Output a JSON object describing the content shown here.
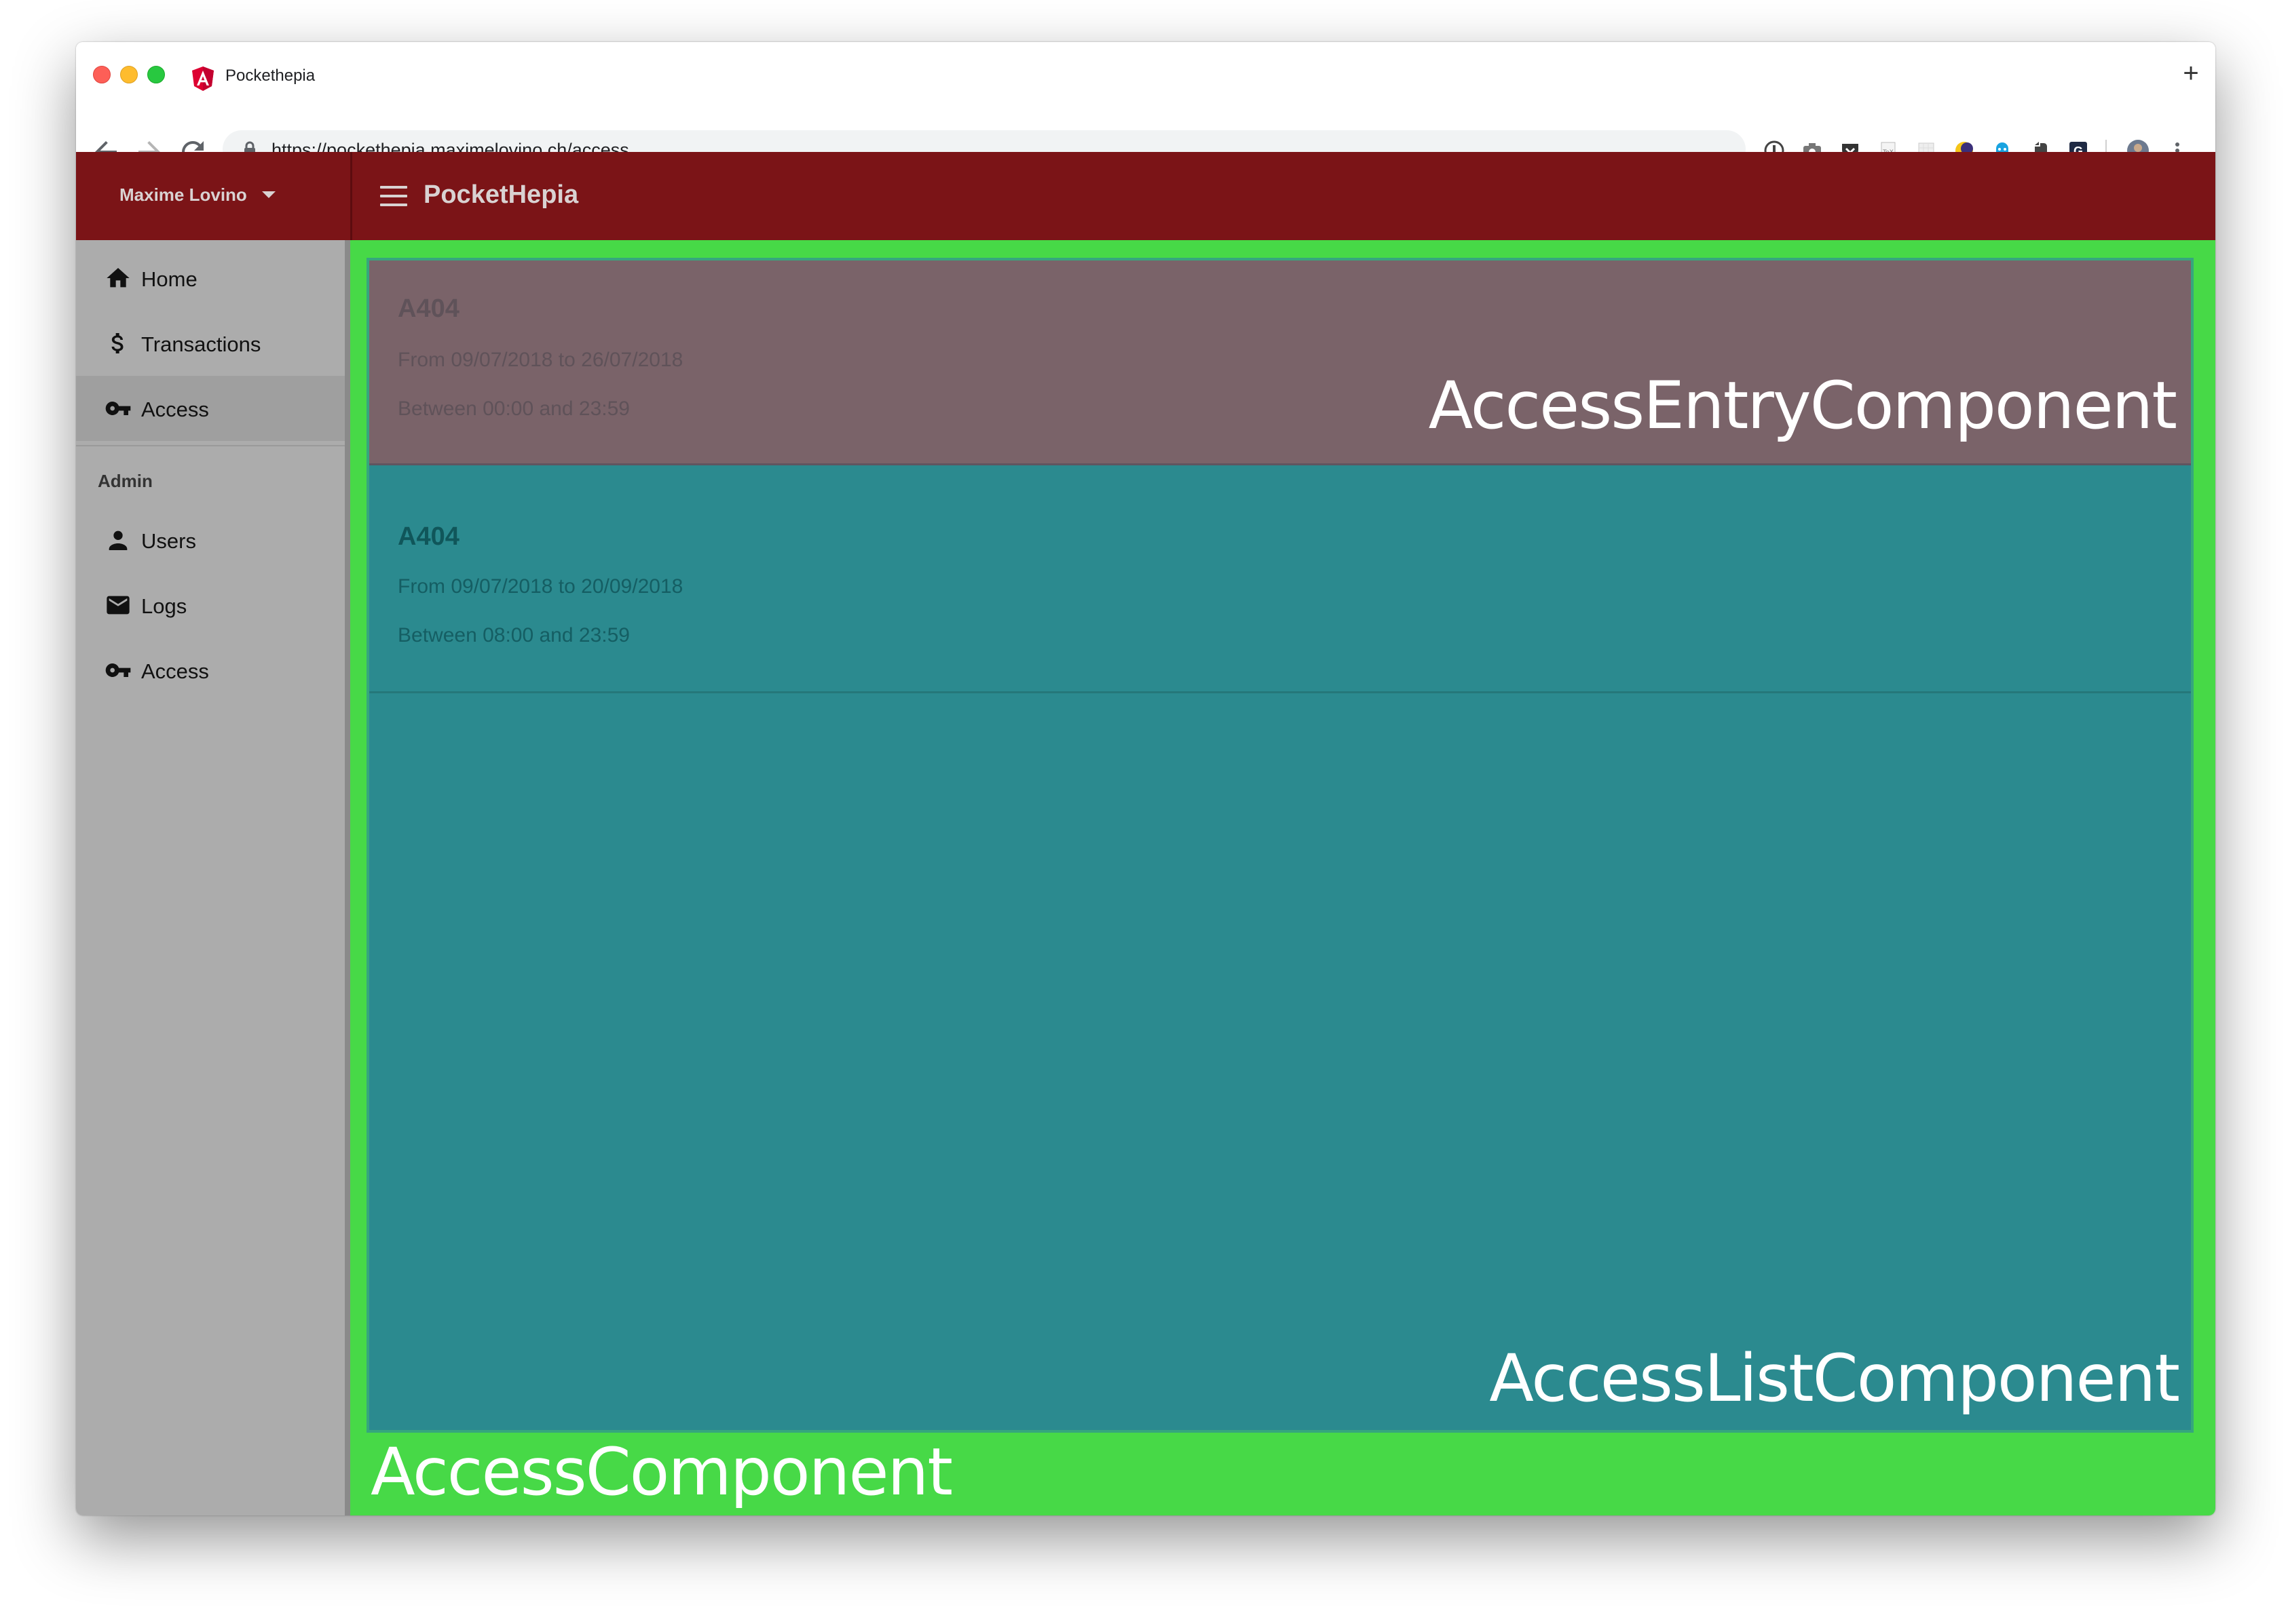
{
  "browser": {
    "tab_title": "Pockethepia",
    "new_tab": "+",
    "url": "https://pockethepia.maximelovino.ch/access"
  },
  "app": {
    "user_name": "Maxime Lovino",
    "title": "PocketHepia",
    "nav": {
      "home": "Home",
      "transactions": "Transactions",
      "access": "Access",
      "admin_header": "Admin",
      "users": "Users",
      "logs": "Logs",
      "admin_access": "Access"
    },
    "entries": [
      {
        "room": "A404",
        "dates": "From 09/07/2018 to 26/07/2018",
        "hours": "Between 00:00 and 23:59"
      },
      {
        "room": "A404",
        "dates": "From 09/07/2018 to 20/09/2018",
        "hours": "Between 08:00 and 23:59"
      }
    ]
  },
  "annotations": {
    "entry_component": "AccessEntryComponent",
    "list_component": "AccessListComponent",
    "access_component": "AccessComponent"
  },
  "colors": {
    "appbar": "#7b1417",
    "sidebar": "#acacac",
    "access_component": "#47d947",
    "access_list_component": "#2b8a8f",
    "access_entry_component": "#7a6369"
  }
}
